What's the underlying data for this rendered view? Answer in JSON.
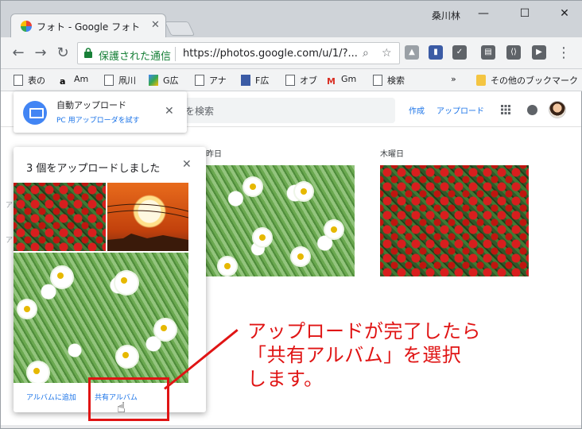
{
  "window": {
    "tab_title": "フォト - Google フォト",
    "user_name": "桑川林",
    "minimize": "—",
    "maximize": "☐",
    "close": "✕"
  },
  "toolbar": {
    "secure_label": "保護された通信",
    "url": "https://photos.google.com/u/1/?...",
    "back": "←",
    "forward": "→",
    "reload": "↻"
  },
  "bookmarks": {
    "items": [
      "表の",
      "Am",
      "凧川",
      "G広",
      "アナ",
      "F広",
      "オブ",
      "Gm",
      "検索"
    ],
    "overflow": "»",
    "other": "その他のブックマーク"
  },
  "photos_header": {
    "search_placeholder": "を検索",
    "create": "作成",
    "upload": "アップロード"
  },
  "dates": {
    "yesterday": "昨日",
    "thursday": "木曜日"
  },
  "notification": {
    "title": "自動アップロード",
    "link": "PC 用アップローダを試す"
  },
  "upload_card": {
    "title": "3 個をアップロードしました",
    "add_to_album": "アルバムに追加",
    "shared_album": "共有アルバム"
  },
  "annotation": {
    "line1": "アップロードが完了したら",
    "line2": "「共有アルバム」を選択",
    "line3": "します。"
  },
  "colors": {
    "accent": "#1a73e8",
    "annotation_red": "#e01414",
    "secure_green": "#188038"
  }
}
